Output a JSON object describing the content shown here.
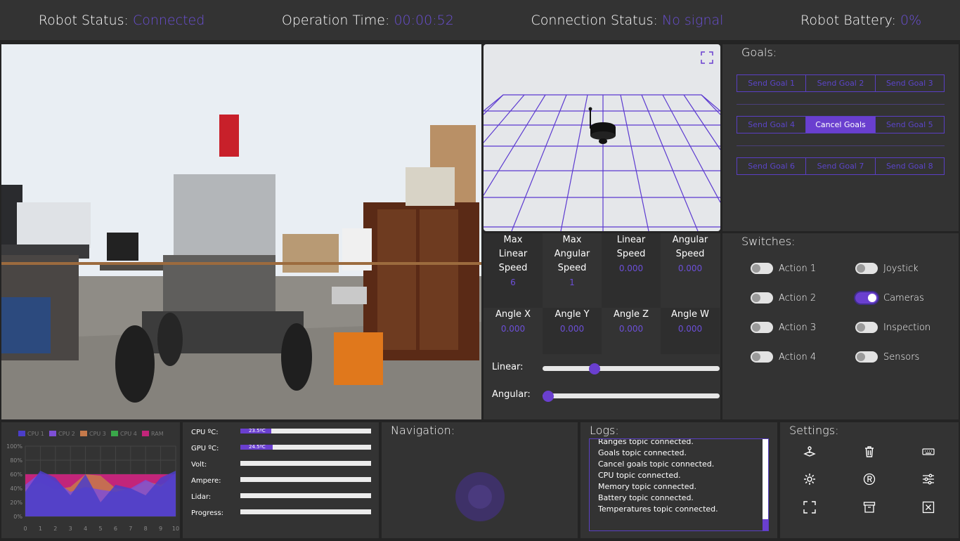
{
  "header": {
    "robot_status_label": "Robot Status:",
    "robot_status_value": "Connected",
    "operation_time_label": "Operation Time:",
    "operation_time_value": "00:00:52",
    "connection_status_label": "Connection Status:",
    "connection_status_value": "No signal",
    "battery_label": "Robot Battery:",
    "battery_value": "0%"
  },
  "velocity": {
    "max_linear_label": "Max Linear Speed",
    "max_linear_value": "6",
    "max_angular_label": "Max Angular Speed",
    "max_angular_value": "1",
    "linear_label": "Linear Speed",
    "linear_value": "0.000",
    "angular_label": "Angular Speed",
    "angular_value": "0.000",
    "angle_x_label": "Angle X",
    "angle_x_value": "0.000",
    "angle_y_label": "Angle Y",
    "angle_y_value": "0.000",
    "angle_z_label": "Angle Z",
    "angle_z_value": "0.000",
    "angle_w_label": "Angle W",
    "angle_w_value": "0.000",
    "linear_slider_label": "Linear:",
    "linear_slider_fraction": 0.28,
    "angular_slider_label": "Angular:",
    "angular_slider_fraction": 0.0
  },
  "goals": {
    "title": "Goals:",
    "row1": [
      "Send Goal 1",
      "Send Goal 2",
      "Send Goal 3"
    ],
    "row2": [
      "Send Goal 4",
      "Cancel Goals",
      "Send Goal 5"
    ],
    "row3": [
      "Send Goal 6",
      "Send Goal 7",
      "Send Goal 8"
    ]
  },
  "switches": {
    "title": "Switches:",
    "items": [
      {
        "label": "Action 1",
        "on": false
      },
      {
        "label": "Action 2",
        "on": false
      },
      {
        "label": "Action 3",
        "on": false
      },
      {
        "label": "Action 4",
        "on": false
      },
      {
        "label": "Joystick",
        "on": false
      },
      {
        "label": "Cameras",
        "on": true
      },
      {
        "label": "Inspection",
        "on": false
      },
      {
        "label": "Sensors",
        "on": false
      }
    ]
  },
  "sensors": {
    "cpu_label": "CPU ºC:",
    "cpu_value": "23.5ºC",
    "cpu_fraction": 0.235,
    "gpu_label": "GPU ºC:",
    "gpu_value": "24.5ºC",
    "gpu_fraction": 0.245,
    "volt_label": "Volt:",
    "ampere_label": "Ampere:",
    "lidar_label": "Lidar:",
    "progress_label": "Progress:"
  },
  "navigation": {
    "title": "Navigation:"
  },
  "logs": {
    "title": "Logs:",
    "lines": [
      "Ranges topic connected.",
      "Goals topic connected.",
      "Cancel goals topic connected.",
      "CPU topic connected.",
      "Memory topic connected.",
      "Battery topic connected.",
      "Temperatures topic connected."
    ]
  },
  "settings": {
    "title": "Settings:",
    "icons": [
      "joystick-icon",
      "trash-icon",
      "keyboard-icon",
      "settings-gear-icon",
      "registered-icon",
      "sliders-icon",
      "fullscreen-icon",
      "archive-icon",
      "close-box-icon"
    ]
  },
  "chart_data": {
    "type": "area",
    "legend": [
      "CPU 1",
      "CPU 2",
      "CPU 3",
      "CPU 4",
      "RAM"
    ],
    "colors": [
      "#4b3ec9",
      "#7e4fd6",
      "#c57a4b",
      "#3aa84a",
      "#c2257a"
    ],
    "x": [
      0,
      1,
      2,
      3,
      4,
      5,
      6,
      7,
      8,
      9,
      10
    ],
    "yticks": [
      "0%",
      "20%",
      "40%",
      "60%",
      "80%",
      "100%"
    ],
    "series": [
      {
        "name": "RAM",
        "values": [
          60,
          60,
          60,
          60,
          60,
          60,
          60,
          60,
          60,
          60,
          60
        ]
      },
      {
        "name": "CPU 3",
        "values": [
          40,
          48,
          38,
          42,
          60,
          58,
          40,
          38,
          50,
          45,
          55
        ]
      },
      {
        "name": "CPU 2",
        "values": [
          45,
          62,
          50,
          35,
          42,
          38,
          35,
          40,
          52,
          42,
          62
        ]
      },
      {
        "name": "CPU 1",
        "values": [
          35,
          65,
          55,
          30,
          60,
          20,
          45,
          40,
          30,
          55,
          65
        ]
      }
    ],
    "ylim": [
      0,
      100
    ]
  }
}
